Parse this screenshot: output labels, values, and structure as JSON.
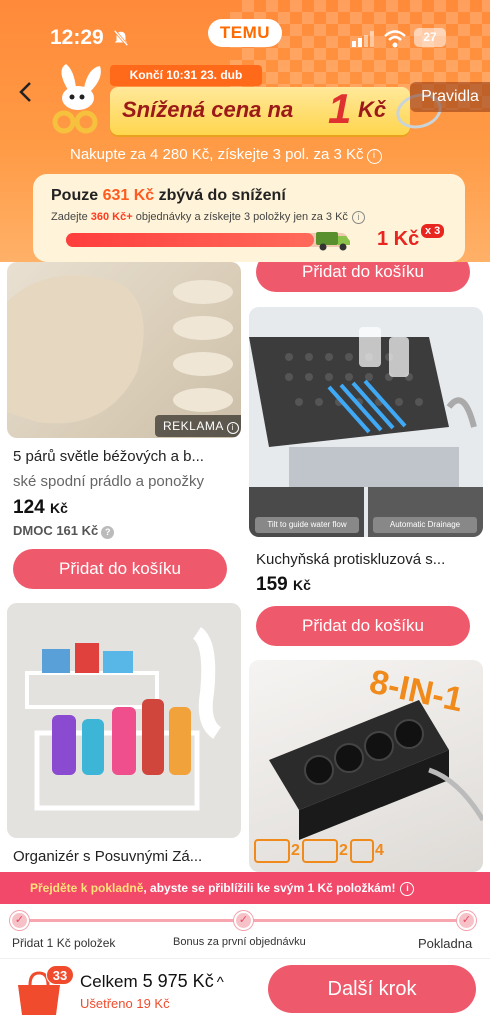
{
  "status_bar": {
    "time": "12:29",
    "brand": "TEMU",
    "battery": "27"
  },
  "header": {
    "ends_text": "Končí 10:31 23. dub",
    "banner_text": "Snížená cena na",
    "banner_big": "1",
    "banner_currency": "Kč",
    "rules_label": "Pravidla",
    "subline": "Nakupte za 4 280 Kč, získejte 3 pol. za 3 Kč"
  },
  "progress": {
    "remain_prefix": "Pouze",
    "remain_amount": "631 Kč",
    "remain_suffix": "zbývá do snížení",
    "hint_prefix": "Zadejte",
    "hint_amount": "360 Kč+",
    "hint_suffix": "objednávky a získejte 3 položky jen za 3 Kč",
    "fill_fraction": 0.88,
    "reward_price": "1 Kč",
    "reward_multiplier": "x 3"
  },
  "products": {
    "top_right_button": "Přidat do košíku",
    "p1": {
      "ad_label": "REKLAMA",
      "title": "5 párů světle béžových a b...",
      "subtitle": "ské spodní prádlo a ponožky",
      "price": "124",
      "currency": "Kč",
      "seller": "DMOC 161 Kč",
      "button": "Přidat do košíku"
    },
    "p2": {
      "img_caption_left": "Tilt to guide water flow",
      "img_caption_right": "Automatic Drainage",
      "title": "Kuchyňská protiskluzová s...",
      "price": "159",
      "currency": "Kč",
      "button": "Přidat do košíku"
    },
    "p3": {
      "title": "Organizér s Posuvnými Zá..."
    },
    "p4": {
      "img_text": "8-IN-1",
      "spec_a": "2",
      "spec_b": "2",
      "spec_c": "4"
    }
  },
  "checkout_prompt": {
    "highlight": "Přejděte k pokladně",
    "rest": ", abyste se přiblížili ke svým 1 Kč položkám!"
  },
  "steps": {
    "s1": "Přidat 1 Kč položek",
    "s2": "Bonus za první objednávku",
    "s3": "Pokladna"
  },
  "footer": {
    "bag_count": "33",
    "total_label": "Celkem",
    "total_value": "5 975 Kč",
    "saved": "Ušetřeno 19 Kč",
    "next_button": "Další krok"
  },
  "colors": {
    "header_orange": "#ff8a3a",
    "cta_pink": "#ee5a6c",
    "prompt_red": "#f2486a",
    "price_red": "#e8251f"
  }
}
